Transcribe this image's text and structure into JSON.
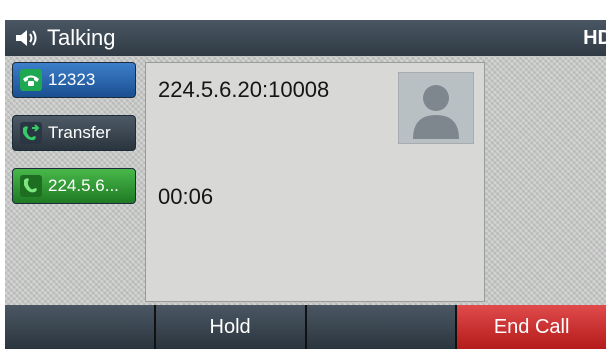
{
  "status": {
    "title": "Talking",
    "indicator": "HD",
    "speaker_icon": "speaker-icon"
  },
  "lines": [
    {
      "label": "12323",
      "icon": "phone-icon",
      "color": "#2a6fbd"
    },
    {
      "label": "Transfer",
      "icon": "transfer-icon",
      "color": "#3a4652"
    },
    {
      "label": "224.5.6...",
      "icon": "active-call-icon",
      "color": "#2f9d33"
    }
  ],
  "call": {
    "address": "224.5.6.20:10008",
    "duration": "00:06",
    "avatar_icon": "contact-avatar-icon"
  },
  "softkeys": [
    {
      "label": ""
    },
    {
      "label": "Hold"
    },
    {
      "label": ""
    },
    {
      "label": "End Call",
      "color": "#d32f2f"
    }
  ]
}
